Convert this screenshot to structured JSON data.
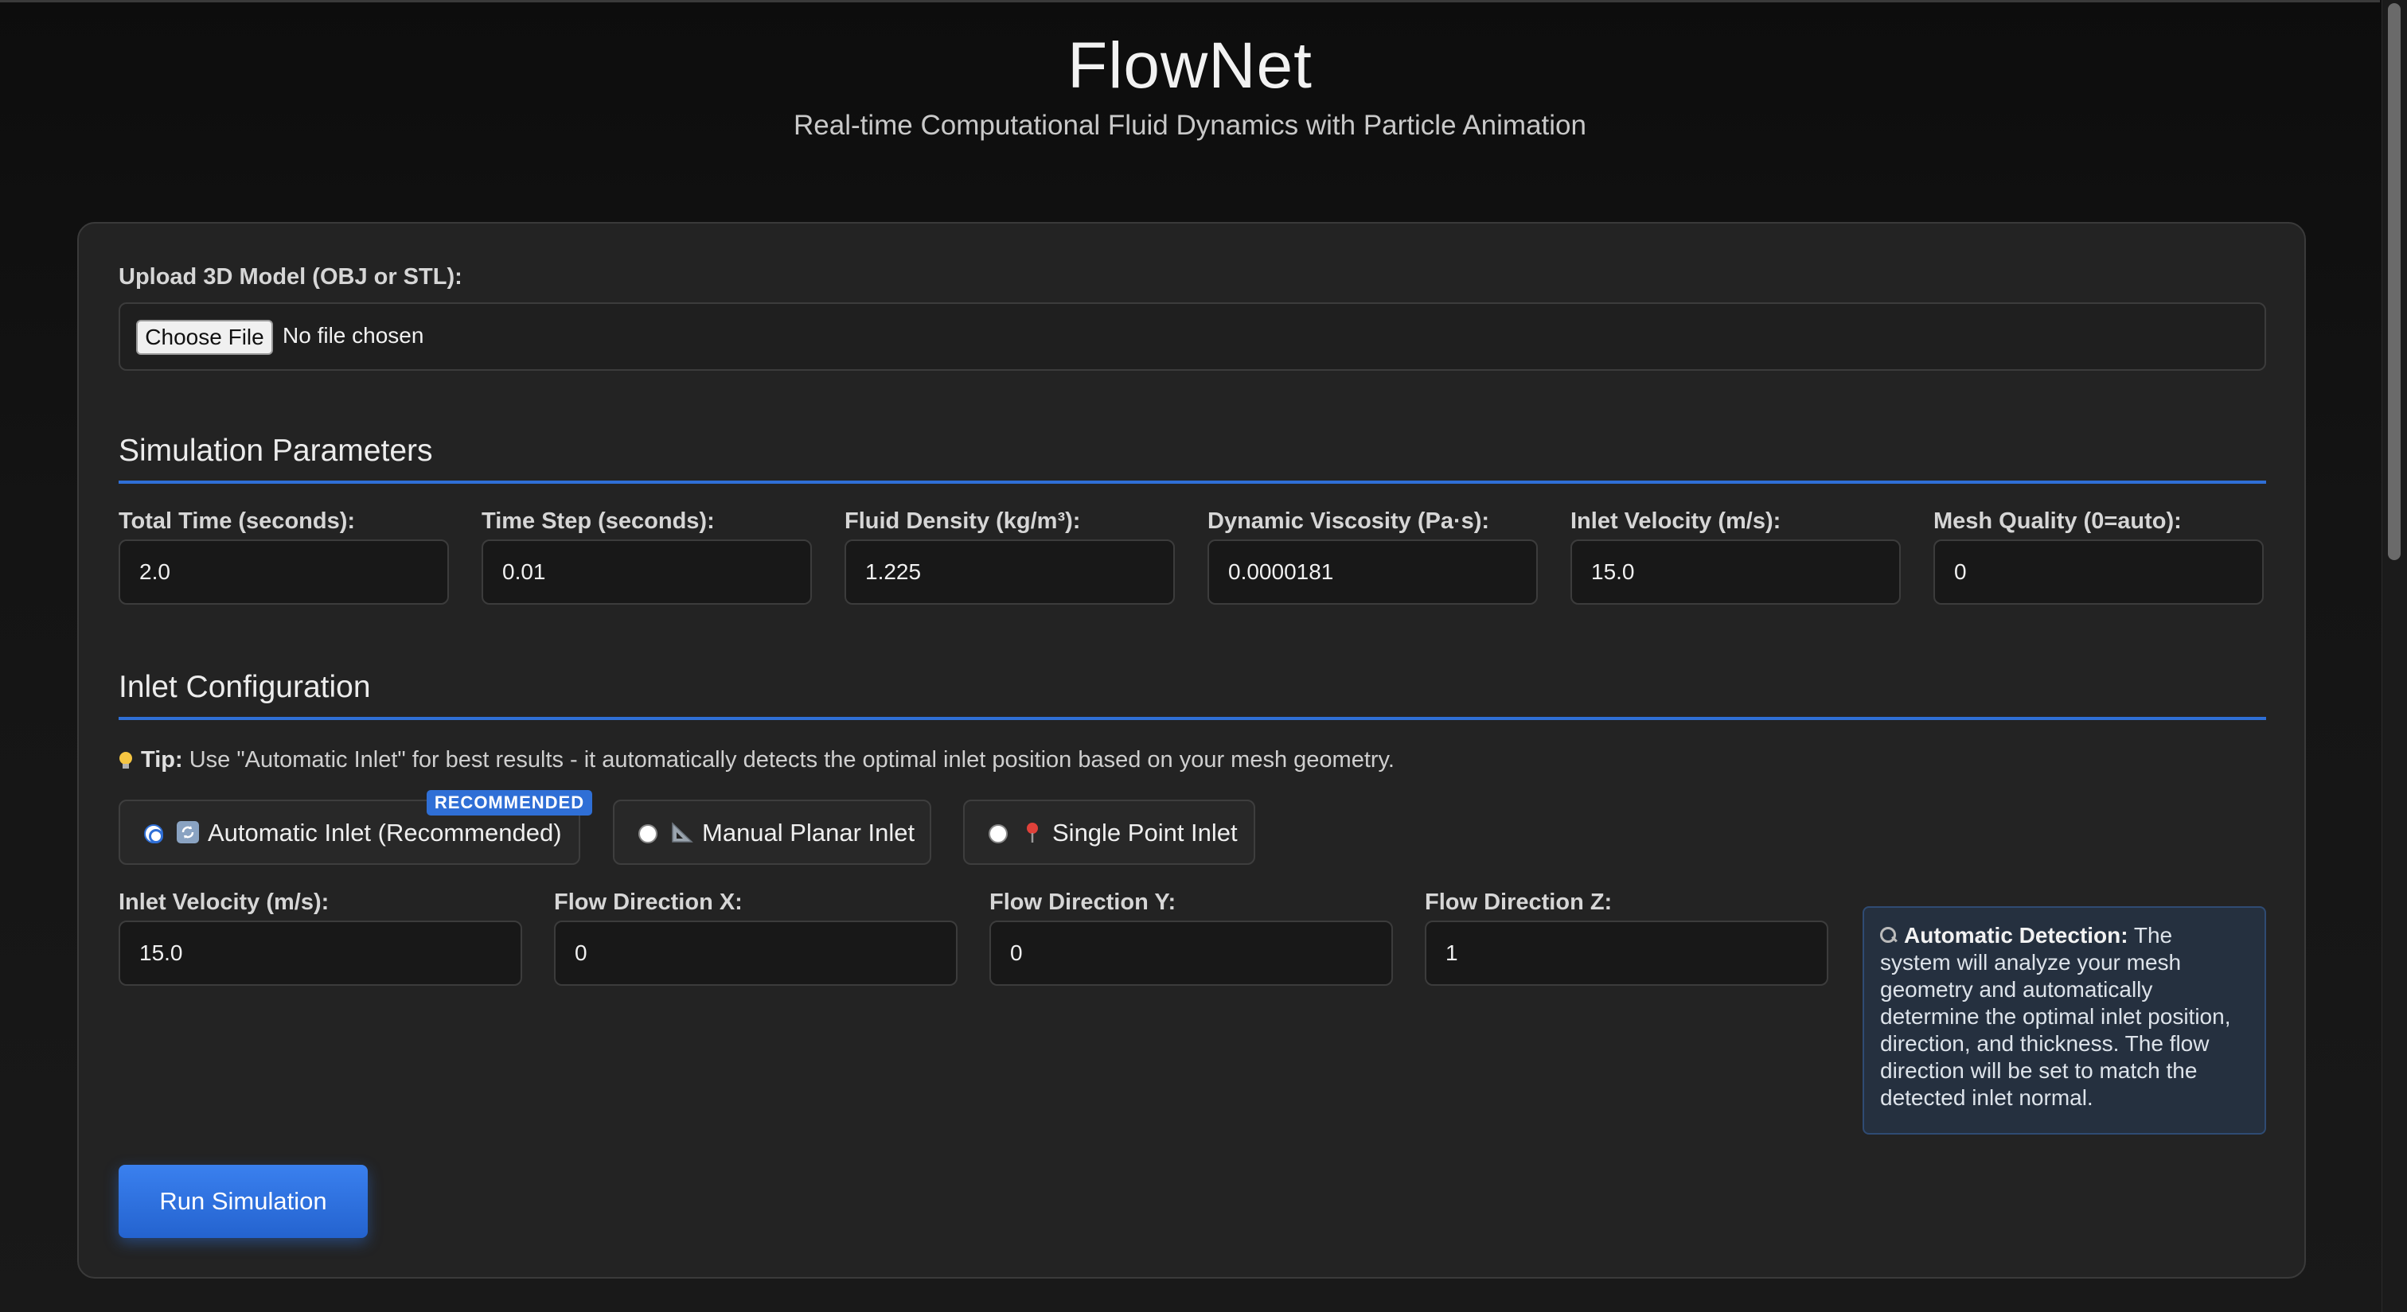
{
  "app": {
    "title": "FlowNet",
    "subtitle": "Real-time Computational Fluid Dynamics with Particle Animation"
  },
  "upload": {
    "label": "Upload 3D Model (OBJ or STL):",
    "button_label": "Choose File",
    "status": "No file chosen"
  },
  "simulation": {
    "title": "Simulation Parameters",
    "params": [
      {
        "label": "Total Time (seconds):",
        "value": "2.0"
      },
      {
        "label": "Time Step (seconds):",
        "value": "0.01"
      },
      {
        "label": "Fluid Density (kg/m³):",
        "value": "1.225"
      },
      {
        "label": "Dynamic Viscosity (Pa·s):",
        "value": "0.0000181"
      },
      {
        "label": "Inlet Velocity (m/s):",
        "value": "15.0"
      },
      {
        "label": "Mesh Quality (0=auto):",
        "value": "0"
      }
    ]
  },
  "inlet": {
    "title": "Inlet Configuration",
    "tip_bold": "Tip:",
    "tip_text": "Use \"Automatic Inlet\" for best results - it automatically detects the optimal inlet position based on your mesh geometry.",
    "options": [
      {
        "label": "Automatic Inlet (Recommended)",
        "icon": "refresh-icon",
        "checked": true
      },
      {
        "label": "Manual Planar Inlet",
        "icon": "triangle-ruler-icon",
        "checked": false
      },
      {
        "label": "Single Point Inlet",
        "icon": "pushpin-icon",
        "checked": false
      }
    ],
    "badge": "RECOMMENDED",
    "fields": [
      {
        "label": "Inlet Velocity (m/s):",
        "value": "15.0"
      },
      {
        "label": "Flow Direction X:",
        "value": "0"
      },
      {
        "label": "Flow Direction Y:",
        "value": "0"
      },
      {
        "label": "Flow Direction Z:",
        "value": "1"
      }
    ],
    "info_bold": "Automatic Detection:",
    "info_text": "The system will analyze your mesh geometry and automatically determine the optimal inlet position, direction, and thickness. The flow direction will be set to match the detected inlet normal."
  },
  "actions": {
    "run_label": "Run Simulation"
  },
  "colors": {
    "accent": "#2f6fd6",
    "background": "#0f0f0f",
    "panel": "#232323"
  }
}
